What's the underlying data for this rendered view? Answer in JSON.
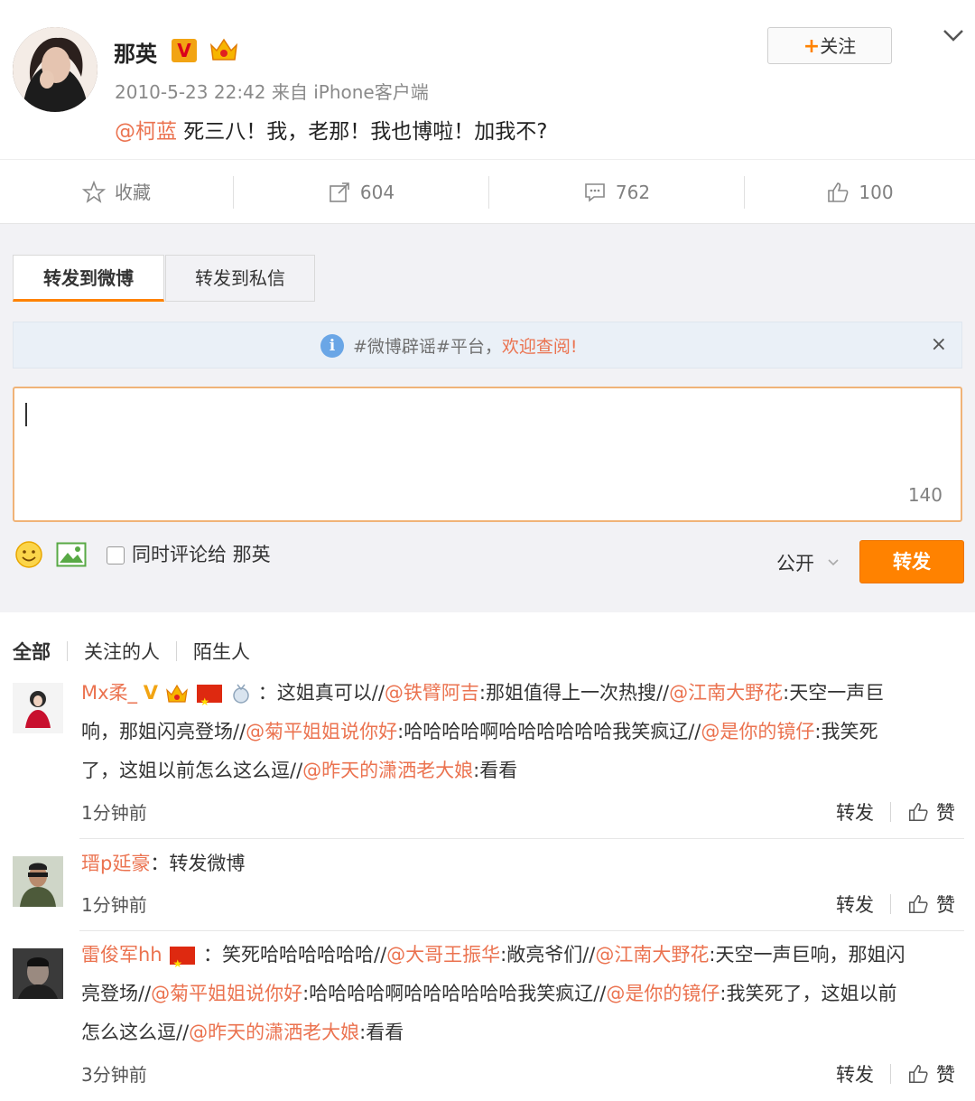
{
  "post": {
    "author": "那英",
    "meta": "2010-5-23 22:42 来自 iPhone客户端",
    "mention": "@柯蓝",
    "text": " 死三八！我，老那！我也博啦！加我不?",
    "follow_label": "关注",
    "follow_plus": "+"
  },
  "actions": {
    "favorite": "收藏",
    "repost_count": "604",
    "comment_count": "762",
    "like_count": "100"
  },
  "repost_panel": {
    "tab_weibo": "转发到微博",
    "tab_private": "转发到私信",
    "notice_prefix": "#微博辟谣#平台，",
    "notice_link": "欢迎查阅!",
    "notice_close": "×",
    "char_count": "140",
    "also_comment_label": "同时评论给 那英",
    "visibility": "公开",
    "submit_label": "转发"
  },
  "filters": [
    "全部",
    "关注的人",
    "陌生人"
  ],
  "comments": [
    {
      "user": "Mx柔_",
      "badge_v": "V",
      "separator": "：",
      "seg1": "这姐真可以//",
      "m1": "@铁臂阿吉",
      "seg2": ":那姐值得上一次热搜//",
      "m2": "@江南大野花",
      "seg3": ":天空一声巨",
      "line2_a": "响，那姐闪亮登场//",
      "m3": "@菊平姐姐说你好",
      "seg4": ":哈哈哈哈啊哈哈哈哈哈哈我笑疯辽//",
      "m4": "@是你的镜仔",
      "seg5": ":我笑死",
      "line3_a": "了，这姐以前怎么这么逗//",
      "m5": "@昨天的潇洒老大娘",
      "seg6": ":看看",
      "time": "1分钟前",
      "repost": "转发",
      "like": "赞"
    },
    {
      "user": "瑨p延豪",
      "separator": "：",
      "text": "转发微博",
      "time": "1分钟前",
      "repost": "转发",
      "like": "赞"
    },
    {
      "user": "雷俊军hh",
      "separator": "：",
      "seg1": "笑死哈哈哈哈哈哈//",
      "m1": "@大哥王振华",
      "seg2": ":敞亮爷们//",
      "m2": "@江南大野花",
      "seg3": ":天空一声巨响，那姐闪",
      "line2_a": "亮登场//",
      "m3": "@菊平姐姐说你好",
      "seg4": ":哈哈哈哈啊哈哈哈哈哈哈我笑疯辽//",
      "m4": "@是你的镜仔",
      "seg5": ":我笑死了，这姐以前",
      "line3_a": "怎么这么逗//",
      "m5": "@昨天的潇洒老大娘",
      "seg6": ":看看",
      "time": "3分钟前",
      "repost": "转发",
      "like": "赞"
    }
  ],
  "colors": {
    "accent": "#ff8200",
    "mention": "#eb7350",
    "notice_bg": "#eaf0f7"
  }
}
